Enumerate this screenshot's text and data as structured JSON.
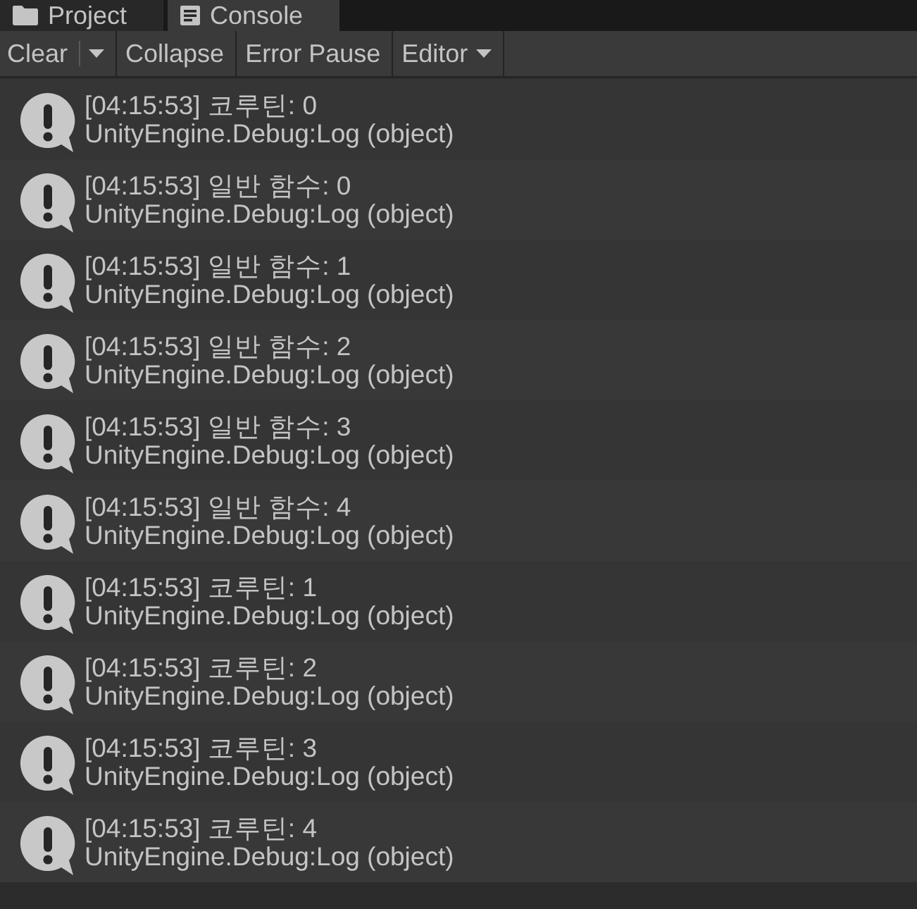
{
  "tabs": [
    {
      "label": "Project",
      "kind": "project",
      "selected": false
    },
    {
      "label": "Console",
      "kind": "console",
      "selected": true
    }
  ],
  "toolbar": {
    "buttons": [
      {
        "label": "Clear",
        "kind": "split"
      },
      {
        "label": "Collapse",
        "kind": "button"
      },
      {
        "label": "Error Pause",
        "kind": "button"
      },
      {
        "label": "Editor",
        "kind": "dropdown"
      }
    ]
  },
  "log_entries": [
    {
      "message": "[04:15:53] 코루틴: 0",
      "trace": "UnityEngine.Debug:Log (object)"
    },
    {
      "message": "[04:15:53] 일반 함수: 0",
      "trace": "UnityEngine.Debug:Log (object)"
    },
    {
      "message": "[04:15:53] 일반 함수: 1",
      "trace": "UnityEngine.Debug:Log (object)"
    },
    {
      "message": "[04:15:53] 일반 함수: 2",
      "trace": "UnityEngine.Debug:Log (object)"
    },
    {
      "message": "[04:15:53] 일반 함수: 3",
      "trace": "UnityEngine.Debug:Log (object)"
    },
    {
      "message": "[04:15:53] 일반 함수: 4",
      "trace": "UnityEngine.Debug:Log (object)"
    },
    {
      "message": "[04:15:53] 코루틴: 1",
      "trace": "UnityEngine.Debug:Log (object)"
    },
    {
      "message": "[04:15:53] 코루틴: 2",
      "trace": "UnityEngine.Debug:Log (object)"
    },
    {
      "message": "[04:15:53] 코루틴: 3",
      "trace": "UnityEngine.Debug:Log (object)"
    },
    {
      "message": "[04:15:53] 코루틴: 4",
      "trace": "UnityEngine.Debug:Log (object)"
    }
  ]
}
